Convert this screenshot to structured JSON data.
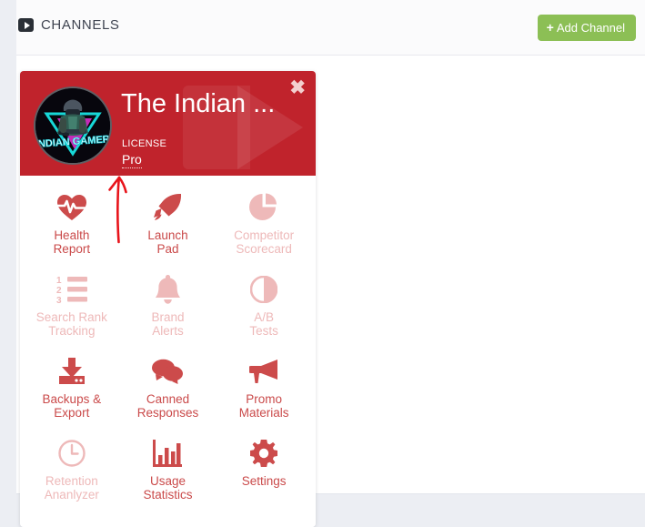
{
  "header": {
    "icon": "play-badge-icon",
    "title": "CHANNELS",
    "add_button_label": "Add Channel",
    "add_button_plus": "+",
    "add_button_color": "#8cbf55"
  },
  "card": {
    "title": "The Indian ...",
    "license_label": "LICENSE",
    "license_value": "Pro",
    "close_label": "✖",
    "banner_color": "#c0232c",
    "avatar_alt": "INDIAN GAMER",
    "avatar_text": "INDIAN GAMER",
    "tiles": [
      {
        "id": "health-report",
        "label_line1": "Health",
        "label_line2": "Report",
        "icon": "heartbeat-icon",
        "enabled": true
      },
      {
        "id": "launch-pad",
        "label_line1": "Launch",
        "label_line2": "Pad",
        "icon": "rocket-icon",
        "enabled": true
      },
      {
        "id": "competitor-scorecard",
        "label_line1": "Competitor",
        "label_line2": "Scorecard",
        "icon": "pie-chart-icon",
        "enabled": false
      },
      {
        "id": "search-rank-tracking",
        "label_line1": "Search Rank",
        "label_line2": "Tracking",
        "icon": "numbered-list-icon",
        "enabled": false
      },
      {
        "id": "brand-alerts",
        "label_line1": "Brand",
        "label_line2": "Alerts",
        "icon": "bell-icon",
        "enabled": false
      },
      {
        "id": "ab-tests",
        "label_line1": "A/B",
        "label_line2": "Tests",
        "icon": "contrast-icon",
        "enabled": false
      },
      {
        "id": "backups-export",
        "label_line1": "Backups &",
        "label_line2": "Export",
        "icon": "download-icon",
        "enabled": true
      },
      {
        "id": "canned-responses",
        "label_line1": "Canned",
        "label_line2": "Responses",
        "icon": "comments-icon",
        "enabled": true
      },
      {
        "id": "promo-materials",
        "label_line1": "Promo",
        "label_line2": "Materials",
        "icon": "megaphone-icon",
        "enabled": true
      },
      {
        "id": "retention-analyzer",
        "label_line1": "Retention",
        "label_line2": "Ananlyzer",
        "icon": "clock-icon",
        "enabled": false
      },
      {
        "id": "usage-statistics",
        "label_line1": "Usage",
        "label_line2": "Statistics",
        "icon": "bar-chart-icon",
        "enabled": true
      },
      {
        "id": "settings",
        "label_line1": "Settings",
        "label_line2": "",
        "icon": "gear-icon",
        "enabled": true
      }
    ]
  },
  "annotation": {
    "type": "hand-drawn-arrow",
    "color": "#e8141b",
    "points_at": "license_value"
  },
  "colors": {
    "page_background": "#eceef3",
    "panel_background": "#ffffff",
    "accent_red": "#c0232c",
    "tile_active": "#ca4a4a",
    "tile_disabled": "#eeb9b9",
    "green": "#8cbf55"
  }
}
